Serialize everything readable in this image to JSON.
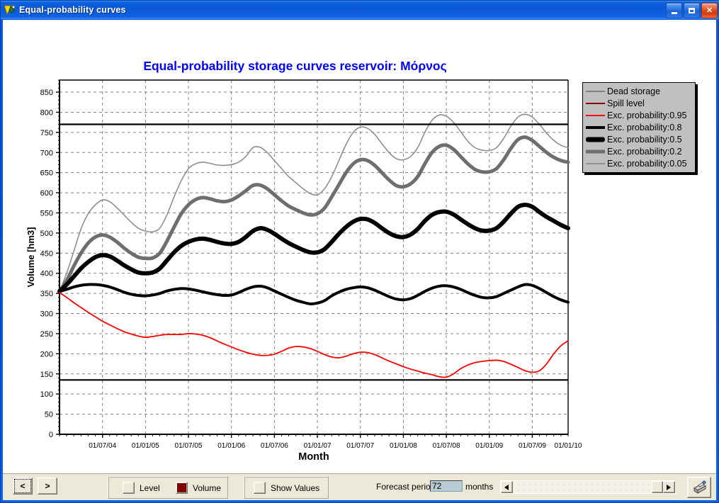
{
  "window": {
    "title": "Equal-probability curves",
    "icon": "app-icon",
    "buttons": {
      "minimize": "minimize-button",
      "maximize": "maximize-button",
      "close": "close-button"
    }
  },
  "chart": {
    "title": "Equal-probability storage curves reservoir: Μόρνος",
    "title_color": "#0000ff",
    "ylabel": "Volume [hm3]",
    "xlabel": "Month",
    "legend": [
      {
        "label": "Dead storage",
        "color": "#808080",
        "width": 1.6
      },
      {
        "label": "Spill level",
        "color": "#800000",
        "width": 1.6
      },
      {
        "label": "Exc. probability:0.95",
        "color": "#ff0000",
        "width": 1.8
      },
      {
        "label": "Exc. probability:0.8",
        "color": "#000000",
        "width": 4.0
      },
      {
        "label": "Exc. probability:0.5",
        "color": "#000000",
        "width": 6.0
      },
      {
        "label": "Exc. probability:0.2",
        "color": "#6e6e6e",
        "width": 5.0
      },
      {
        "label": "Exc. probability:0.05",
        "color": "#8f8f8f",
        "width": 1.6
      }
    ]
  },
  "chart_data": {
    "type": "line",
    "title": "Equal-probability storage curves reservoir: Μόρνος",
    "xlabel": "Month",
    "ylabel": "Volume [hm3]",
    "ylim": [
      0,
      880
    ],
    "ytick_step": 50,
    "yticks": [
      0,
      50,
      100,
      150,
      200,
      250,
      300,
      350,
      400,
      450,
      500,
      550,
      600,
      650,
      700,
      750,
      800,
      850
    ],
    "xtick_labels": [
      "01/07/04",
      "01/01/05",
      "01/07/05",
      "01/01/06",
      "01/07/06",
      "01/01/07",
      "01/07/07",
      "01/01/08",
      "01/07/08",
      "01/01/09",
      "01/07/09",
      "01/01/10"
    ],
    "x_count": 72,
    "grid": true,
    "legend_position": "top-right-outside",
    "reference_lines": [
      {
        "name": "Spill level",
        "value": 770,
        "color": "#000000",
        "width": 2.2
      },
      {
        "name": "Dead storage",
        "value": 135,
        "color": "#000000",
        "width": 2.2
      }
    ],
    "series": [
      {
        "name": "Exc. probability:0.05",
        "color": "#8f8f8f",
        "width": 1.6,
        "values": [
          355,
          400,
          455,
          510,
          548,
          570,
          582,
          578,
          563,
          545,
          527,
          512,
          505,
          503,
          512,
          545,
          590,
          630,
          660,
          672,
          676,
          673,
          669,
          668,
          670,
          676,
          690,
          712,
          713,
          700,
          680,
          660,
          640,
          625,
          610,
          598,
          595,
          610,
          640,
          680,
          720,
          750,
          763,
          760,
          745,
          722,
          700,
          685,
          682,
          690,
          712,
          750,
          780,
          793,
          790,
          775,
          752,
          728,
          712,
          706,
          705,
          712,
          735,
          765,
          788,
          795,
          788,
          770,
          748,
          730,
          718,
          712
        ]
      },
      {
        "name": "Exc. probability:0.2",
        "color": "#6e6e6e",
        "width": 5.0,
        "values": [
          355,
          382,
          418,
          450,
          475,
          490,
          495,
          490,
          478,
          463,
          450,
          440,
          437,
          438,
          450,
          480,
          515,
          548,
          570,
          583,
          588,
          585,
          580,
          578,
          582,
          592,
          605,
          618,
          619,
          610,
          595,
          580,
          567,
          558,
          550,
          545,
          548,
          562,
          590,
          620,
          650,
          672,
          682,
          680,
          668,
          650,
          632,
          618,
          615,
          622,
          640,
          672,
          700,
          715,
          718,
          708,
          690,
          672,
          658,
          652,
          652,
          660,
          682,
          710,
          732,
          738,
          730,
          715,
          700,
          688,
          680,
          676
        ]
      },
      {
        "name": "Exc. probability:0.5",
        "color": "#000000",
        "width": 6.0,
        "values": [
          355,
          372,
          392,
          412,
          428,
          440,
          445,
          442,
          432,
          420,
          410,
          402,
          400,
          402,
          412,
          432,
          452,
          468,
          478,
          484,
          486,
          483,
          478,
          474,
          473,
          478,
          490,
          505,
          512,
          508,
          498,
          486,
          475,
          466,
          458,
          452,
          452,
          460,
          478,
          498,
          515,
          528,
          535,
          534,
          525,
          512,
          500,
          492,
          490,
          496,
          510,
          530,
          545,
          552,
          553,
          546,
          534,
          522,
          512,
          506,
          506,
          512,
          528,
          548,
          565,
          570,
          565,
          552,
          540,
          530,
          520,
          512
        ]
      },
      {
        "name": "Exc. probability:0.8",
        "color": "#000000",
        "width": 4.0,
        "values": [
          355,
          360,
          366,
          370,
          372,
          372,
          370,
          366,
          360,
          353,
          348,
          345,
          344,
          346,
          350,
          356,
          360,
          362,
          361,
          358,
          354,
          350,
          347,
          345,
          346,
          352,
          360,
          366,
          368,
          364,
          356,
          348,
          340,
          333,
          328,
          324,
          326,
          332,
          344,
          353,
          360,
          364,
          366,
          364,
          358,
          350,
          342,
          336,
          334,
          337,
          345,
          355,
          363,
          368,
          369,
          366,
          360,
          352,
          345,
          340,
          339,
          342,
          350,
          358,
          366,
          372,
          370,
          362,
          352,
          342,
          334,
          328
        ]
      },
      {
        "name": "Exc. probability:0.95",
        "color": "#ff0000",
        "width": 1.8,
        "values": [
          352,
          340,
          327,
          315,
          303,
          292,
          281,
          272,
          263,
          255,
          249,
          244,
          241,
          243,
          246,
          248,
          248,
          248,
          250,
          249,
          246,
          240,
          232,
          224,
          217,
          210,
          204,
          199,
          196,
          196,
          199,
          206,
          214,
          218,
          217,
          213,
          206,
          198,
          192,
          190,
          194,
          200,
          204,
          203,
          198,
          190,
          182,
          175,
          168,
          162,
          157,
          152,
          148,
          143,
          142,
          150,
          163,
          172,
          178,
          181,
          183,
          184,
          181,
          174,
          166,
          158,
          154,
          158,
          175,
          200,
          220,
          232
        ]
      }
    ]
  },
  "toolbar": {
    "prev_button": "<",
    "next_button": ">",
    "level_label": "Level",
    "level_checked": false,
    "volume_label": "Volume",
    "volume_checked": true,
    "volume_color": "#800000",
    "show_values_label": "Show Values",
    "show_values_checked": false,
    "forecast_label": "Forecast period",
    "forecast_value": "72",
    "forecast_units": "months",
    "scroll_left_icon": "left-arrow-icon",
    "scroll_right_icon": "right-arrow-icon",
    "print_icon": "printer-icon"
  }
}
